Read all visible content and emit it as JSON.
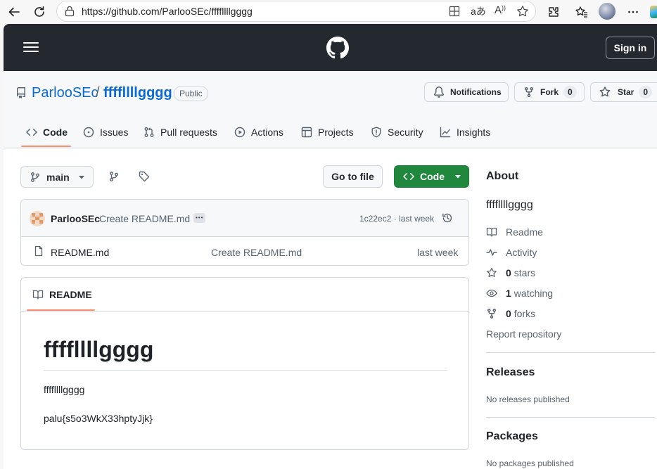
{
  "browser": {
    "url_host": "https://github.com",
    "url_path": "/ParlooSEc/ffffllllgggg",
    "aa_label": "aあ",
    "read_label": "A",
    "icons": [
      "back-icon",
      "refresh-icon",
      "site-info-icon",
      "app-available-icon",
      "translate-icon",
      "read-aloud-icon",
      "favorite-icon",
      "extensions-icon",
      "favorites-icon",
      "profile-avatar",
      "more-icon"
    ]
  },
  "header": {
    "sign_in": "Sign in"
  },
  "repo": {
    "owner": "ParlooSEc",
    "separator": "/",
    "name": "ffffllllgggg",
    "visibility": "Public",
    "notifications_label": "Notifications",
    "fork_label": "Fork",
    "fork_count": "0",
    "star_label": "Star",
    "star_count": "0"
  },
  "tabs": [
    {
      "label": "Code",
      "icon": "code-icon",
      "selected": true
    },
    {
      "label": "Issues",
      "icon": "issue-icon"
    },
    {
      "label": "Pull requests",
      "icon": "pull-request-icon"
    },
    {
      "label": "Actions",
      "icon": "play-icon"
    },
    {
      "label": "Projects",
      "icon": "table-icon"
    },
    {
      "label": "Security",
      "icon": "shield-icon"
    },
    {
      "label": "Insights",
      "icon": "graph-icon"
    }
  ],
  "toolbar": {
    "branch": "main",
    "go_to_file": "Go to file",
    "code": "Code"
  },
  "commit": {
    "author": "ParlooSEc",
    "message": "Create README.md",
    "ellipsis": "•••",
    "hash": "1c22ec2",
    "dot": "·",
    "time": "last week"
  },
  "files": [
    {
      "name": "README.md",
      "message": "Create README.md",
      "time": "last week"
    }
  ],
  "readme": {
    "tab_label": "README",
    "heading": "ffffllllgggg",
    "paragraph1": "ffffllllgggg",
    "paragraph2": "palu{s5o3WkX33hptyJjk}"
  },
  "about": {
    "title": "About",
    "description": "ffffllllgggg",
    "readme": "Readme",
    "activity": "Activity",
    "stars_count": "0",
    "stars_label": "stars",
    "watching_count": "1",
    "watching_label": "watching",
    "forks_count": "0",
    "forks_label": "forks",
    "report": "Report repository"
  },
  "releases": {
    "title": "Releases",
    "empty": "No releases published"
  },
  "packages": {
    "title": "Packages",
    "empty": "No packages published"
  },
  "colors": {
    "header_bg": "#24292f",
    "accent_link": "#0969da",
    "code_button": "#1f883d",
    "selected_tab_underline": "#fd8c73"
  }
}
